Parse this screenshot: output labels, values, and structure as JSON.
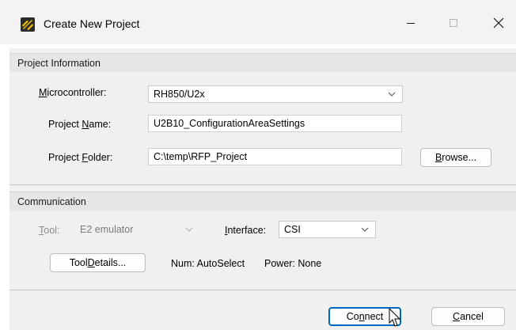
{
  "window": {
    "title": "Create New Project",
    "app_icon": "renesas-flash-programmer-icon"
  },
  "title_buttons": {
    "minimize_icon": "minimize-icon",
    "maximize_icon": "maximize-icon",
    "close_icon": "close-icon"
  },
  "project_info": {
    "group_title": "Project Information",
    "microcontroller": {
      "label_key": "M",
      "label_rest": "icrocontroller:",
      "value": "RH850/U2x"
    },
    "project_name": {
      "label_pre": "Project ",
      "label_key": "N",
      "label_rest": "ame:",
      "value": "U2B10_ConfigurationAreaSettings"
    },
    "project_folder": {
      "label_pre": "Project ",
      "label_key": "F",
      "label_rest": "older:",
      "value": "C:\\temp\\RFP_Project"
    },
    "browse": {
      "key": "B",
      "rest": "rowse..."
    }
  },
  "communication": {
    "group_title": "Communication",
    "tool": {
      "label_key": "T",
      "label_rest": "ool:",
      "value": "E2 emulator",
      "enabled": false
    },
    "interface": {
      "label_key": "I",
      "label_rest": "nterface:",
      "value": "CSI"
    },
    "tool_details": {
      "pre": "Tool ",
      "key": "D",
      "rest": "etails..."
    },
    "status": {
      "num": "Num: AutoSelect",
      "power": "Power: None"
    }
  },
  "footer": {
    "connect": {
      "pre": "Co",
      "key": "n",
      "rest": "nect"
    },
    "cancel": {
      "key": "C",
      "rest": "ancel"
    }
  },
  "colors": {
    "accent": "#0067c0",
    "dialog_bg": "#f0f0f0",
    "group_header_bg": "#e6e6e6"
  }
}
